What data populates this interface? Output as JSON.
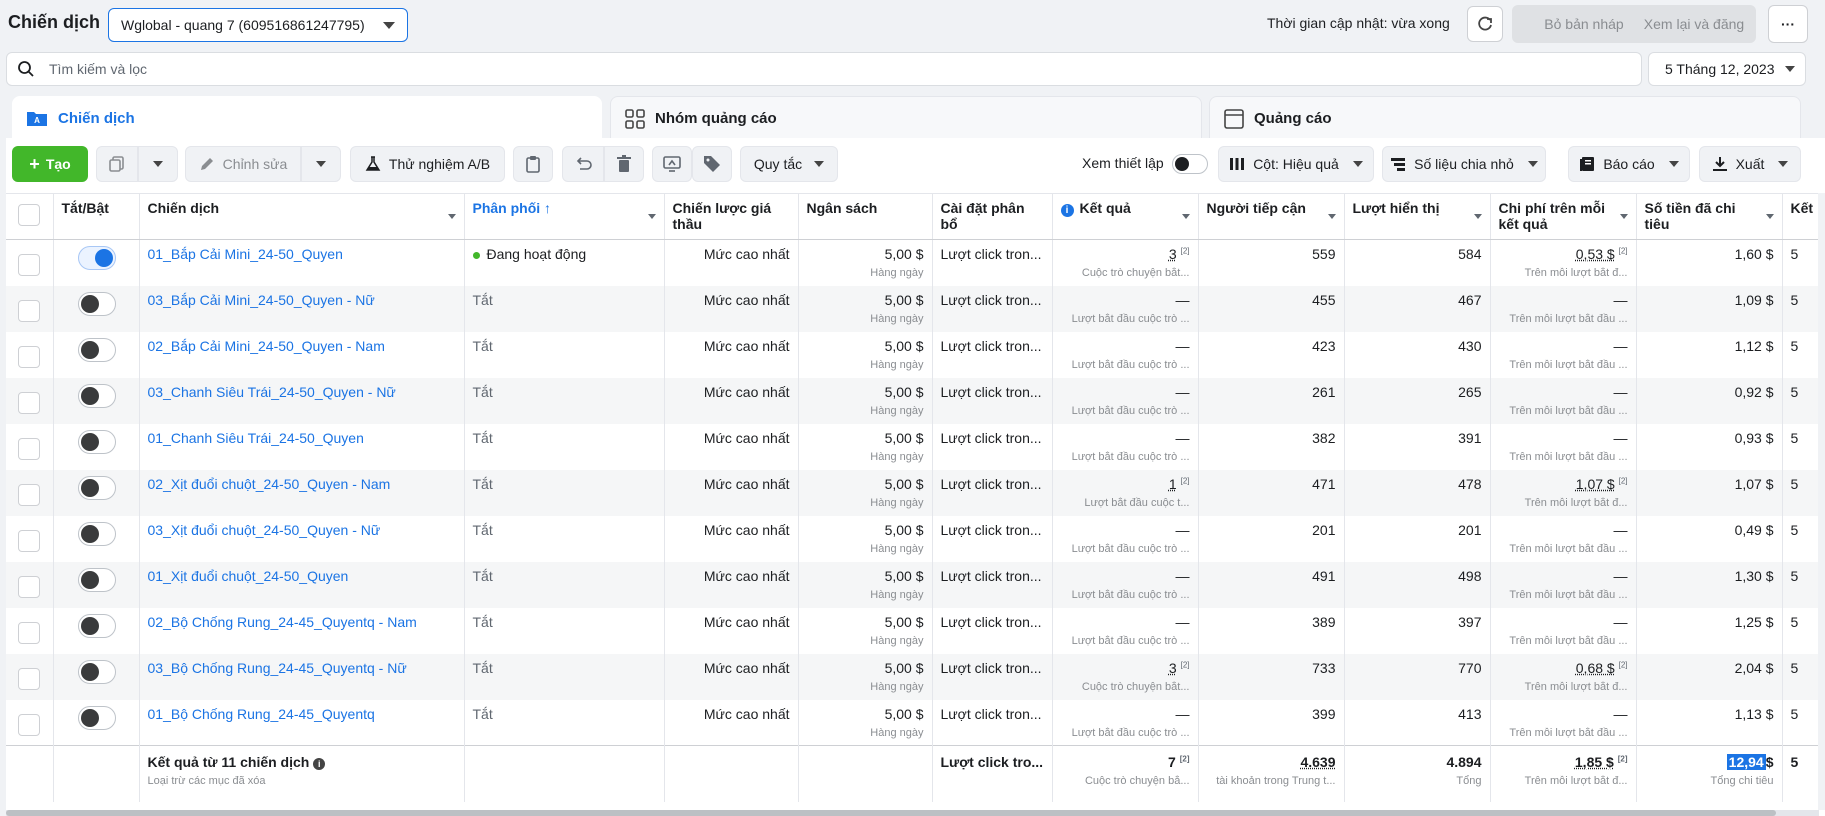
{
  "header": {
    "title": "Chiến dịch",
    "account": "Wglobal - quang 7 (609516861247795)",
    "update_time": "Thời gian cập nhật: vừa xong",
    "discard_label": "Bỏ bản nháp",
    "review_label": "Xem lại và đăng",
    "more_label": "···"
  },
  "search": {
    "placeholder": "Tìm kiếm và lọc"
  },
  "date_range": "5 Tháng 12, 2023",
  "tabs": [
    {
      "label": "Chiến dịch",
      "icon": "folder-icon"
    },
    {
      "label": "Nhóm quảng cáo",
      "icon": "grid-icon"
    },
    {
      "label": "Quảng cáo",
      "icon": "ad-icon"
    }
  ],
  "toolbar": {
    "create": "Tạo",
    "edit": "Chỉnh sửa",
    "ab_test": "Thử nghiệm A/B",
    "rules": "Quy tắc",
    "view_setup": "Xem thiết lập",
    "columns": "Cột: Hiệu quả",
    "breakdown": "Số liệu chia nhỏ",
    "reports": "Báo cáo",
    "export": "Xuất"
  },
  "columns": {
    "toggle": "Tắt/Bật",
    "campaign": "Chiến dịch",
    "delivery": "Phân phối ↑",
    "bid": "Chiến lược giá thầu",
    "budget": "Ngân sách",
    "attribution": "Cài đặt phân bổ",
    "results": "Kết quả",
    "reach": "Người tiếp cận",
    "impressions": "Lượt hiển thị",
    "cpr": "Chi phí trên mỗi kết quả",
    "spent": "Số tiền đã chi tiêu",
    "ends": "Kết"
  },
  "rows": [
    {
      "on": true,
      "name": "01_Bắp Cải Mini_24-50_Quyen",
      "delivery": "Đang hoạt động",
      "active": true,
      "bid": "Mức cao nhất",
      "budget": "5,00 $",
      "budget_sub": "Hàng ngày",
      "attr": "Lượt click tron...",
      "result": "3",
      "result_sup": "[2]",
      "result_sub": "Cuộc trò chuyện bắt...",
      "reach": "559",
      "impr": "584",
      "cpr": "0,53 $",
      "cpr_sup": "[2]",
      "cpr_sub": "Trên mỗi lượt bắt đ...",
      "spent": "1,60 $",
      "ends": "5"
    },
    {
      "on": false,
      "name": "03_Bắp Cải Mini_24-50_Quyen - Nữ",
      "delivery": "Tắt",
      "active": false,
      "bid": "Mức cao nhất",
      "budget": "5,00 $",
      "budget_sub": "Hàng ngày",
      "attr": "Lượt click tron...",
      "result": "—",
      "result_sup": "",
      "result_sub": "Lượt bắt đầu cuộc trò ...",
      "reach": "455",
      "impr": "467",
      "cpr": "—",
      "cpr_sup": "",
      "cpr_sub": "Trên mỗi lượt bắt đầu ...",
      "spent": "1,09 $",
      "ends": "5"
    },
    {
      "on": false,
      "name": "02_Bắp Cải Mini_24-50_Quyen - Nam",
      "delivery": "Tắt",
      "active": false,
      "bid": "Mức cao nhất",
      "budget": "5,00 $",
      "budget_sub": "Hàng ngày",
      "attr": "Lượt click tron...",
      "result": "—",
      "result_sup": "",
      "result_sub": "Lượt bắt đầu cuộc trò ...",
      "reach": "423",
      "impr": "430",
      "cpr": "—",
      "cpr_sup": "",
      "cpr_sub": "Trên mỗi lượt bắt đầu ...",
      "spent": "1,12 $",
      "ends": "5"
    },
    {
      "on": false,
      "name": "03_Chanh Siêu Trái_24-50_Quyen - Nữ",
      "delivery": "Tắt",
      "active": false,
      "bid": "Mức cao nhất",
      "budget": "5,00 $",
      "budget_sub": "Hàng ngày",
      "attr": "Lượt click tron...",
      "result": "—",
      "result_sup": "",
      "result_sub": "Lượt bắt đầu cuộc trò ...",
      "reach": "261",
      "impr": "265",
      "cpr": "—",
      "cpr_sup": "",
      "cpr_sub": "Trên mỗi lượt bắt đầu ...",
      "spent": "0,92 $",
      "ends": "5"
    },
    {
      "on": false,
      "name": "01_Chanh Siêu Trái_24-50_Quyen",
      "delivery": "Tắt",
      "active": false,
      "bid": "Mức cao nhất",
      "budget": "5,00 $",
      "budget_sub": "Hàng ngày",
      "attr": "Lượt click tron...",
      "result": "—",
      "result_sup": "",
      "result_sub": "Lượt bắt đầu cuộc trò ...",
      "reach": "382",
      "impr": "391",
      "cpr": "—",
      "cpr_sup": "",
      "cpr_sub": "Trên mỗi lượt bắt đầu ...",
      "spent": "0,93 $",
      "ends": "5"
    },
    {
      "on": false,
      "name": "02_Xịt đuổi chuột_24-50_Quyen - Nam",
      "delivery": "Tắt",
      "active": false,
      "bid": "Mức cao nhất",
      "budget": "5,00 $",
      "budget_sub": "Hàng ngày",
      "attr": "Lượt click tron...",
      "result": "1",
      "result_sup": "[2]",
      "result_sub": "Lượt bắt đầu cuộc t...",
      "reach": "471",
      "impr": "478",
      "cpr": "1,07 $",
      "cpr_sup": "[2]",
      "cpr_sub": "Trên mỗi lượt bắt đ...",
      "spent": "1,07 $",
      "ends": "5"
    },
    {
      "on": false,
      "name": "03_Xịt đuổi chuột_24-50_Quyen - Nữ",
      "delivery": "Tắt",
      "active": false,
      "bid": "Mức cao nhất",
      "budget": "5,00 $",
      "budget_sub": "Hàng ngày",
      "attr": "Lượt click tron...",
      "result": "—",
      "result_sup": "",
      "result_sub": "Lượt bắt đầu cuộc trò ...",
      "reach": "201",
      "impr": "201",
      "cpr": "—",
      "cpr_sup": "",
      "cpr_sub": "Trên mỗi lượt bắt đầu ...",
      "spent": "0,49 $",
      "ends": "5"
    },
    {
      "on": false,
      "name": "01_Xịt đuổi chuột_24-50_Quyen",
      "delivery": "Tắt",
      "active": false,
      "bid": "Mức cao nhất",
      "budget": "5,00 $",
      "budget_sub": "Hàng ngày",
      "attr": "Lượt click tron...",
      "result": "—",
      "result_sup": "",
      "result_sub": "Lượt bắt đầu cuộc trò ...",
      "reach": "491",
      "impr": "498",
      "cpr": "—",
      "cpr_sup": "",
      "cpr_sub": "Trên mỗi lượt bắt đầu ...",
      "spent": "1,30 $",
      "ends": "5"
    },
    {
      "on": false,
      "name": "02_Bộ Chống Rung_24-45_Quyentq - Nam",
      "delivery": "Tắt",
      "active": false,
      "bid": "Mức cao nhất",
      "budget": "5,00 $",
      "budget_sub": "Hàng ngày",
      "attr": "Lượt click tron...",
      "result": "—",
      "result_sup": "",
      "result_sub": "Lượt bắt đầu cuộc trò ...",
      "reach": "389",
      "impr": "397",
      "cpr": "—",
      "cpr_sup": "",
      "cpr_sub": "Trên mỗi lượt bắt đầu ...",
      "spent": "1,25 $",
      "ends": "5"
    },
    {
      "on": false,
      "name": "03_Bộ Chống Rung_24-45_Quyentq - Nữ",
      "delivery": "Tắt",
      "active": false,
      "bid": "Mức cao nhất",
      "budget": "5,00 $",
      "budget_sub": "Hàng ngày",
      "attr": "Lượt click tron...",
      "result": "3",
      "result_sup": "[2]",
      "result_sub": "Cuộc trò chuyện bắt...",
      "reach": "733",
      "impr": "770",
      "cpr": "0,68 $",
      "cpr_sup": "[2]",
      "cpr_sub": "Trên mỗi lượt bắt đ...",
      "spent": "2,04 $",
      "ends": "5"
    },
    {
      "on": false,
      "name": "01_Bộ Chống Rung_24-45_Quyentq",
      "delivery": "Tắt",
      "active": false,
      "bid": "Mức cao nhất",
      "budget": "5,00 $",
      "budget_sub": "Hàng ngày",
      "attr": "Lượt click tron...",
      "result": "—",
      "result_sup": "",
      "result_sub": "Lượt bắt đầu cuộc trò ...",
      "reach": "399",
      "impr": "413",
      "cpr": "—",
      "cpr_sup": "",
      "cpr_sub": "Trên mỗi lượt bắt đầu ...",
      "spent": "1,13 $",
      "ends": "5"
    }
  ],
  "totals": {
    "label": "Kết quả từ 11 chiến dịch",
    "sub": "Loại trừ các mục đã xóa",
    "attr": "Lượt click tro...",
    "result": "7",
    "result_sup": "[2]",
    "result_sub": "Cuộc trò chuyện bắ...",
    "reach": "4.639",
    "reach_sub": "tài khoản trong Trung t...",
    "impr": "4.894",
    "impr_sub": "Tổng",
    "cpr": "1,85 $",
    "cpr_sup": "[2]",
    "cpr_sub": "Trên mỗi lượt bắt đ...",
    "spent_hl": "12,94",
    "spent_unit": "$",
    "spent_sub": "Tổng chi tiêu",
    "ends": "5"
  }
}
